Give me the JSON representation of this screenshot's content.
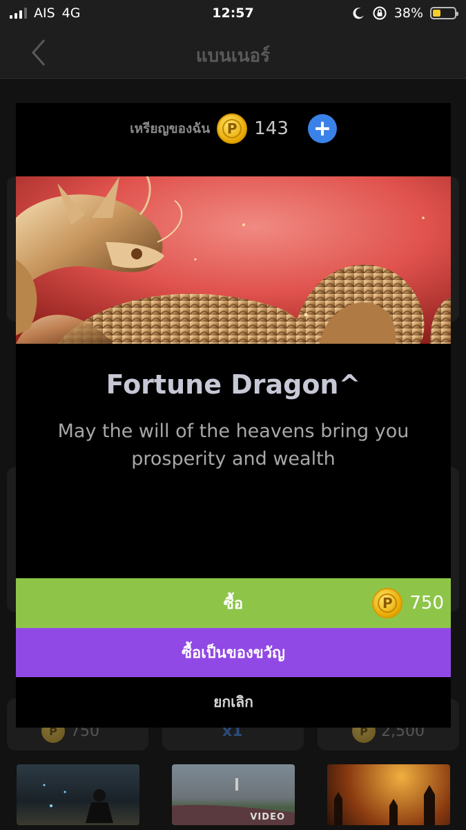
{
  "status_bar": {
    "carrier": "AIS",
    "network": "4G",
    "time": "12:57",
    "battery": "38%",
    "battery_level": 0.38,
    "icons": [
      "signal-icon",
      "moon-icon",
      "rotation-lock-icon",
      "battery-icon"
    ]
  },
  "header": {
    "title": "แบนเนอร์",
    "back_icon": "chevron-left-icon"
  },
  "modal": {
    "wallet_label": "เหรียญของฉัน",
    "coin_symbol": "P",
    "coin_count": "143",
    "add_icon": "plus-icon",
    "banner_image": "golden-dragon-on-red",
    "item_title": "Fortune Dragon^",
    "item_description": "May the will of the heavens bring you prosperity and wealth",
    "buy_label": "ซื้อ",
    "buy_price": "750",
    "gift_label": "ซื้อเป็นของขวัญ",
    "cancel_label": "ยกเลิก"
  },
  "background": {
    "prices": [
      "750",
      "x1",
      "2,500"
    ],
    "video_tag": "VIDEO"
  },
  "colors": {
    "buy": "#8ec549",
    "gift": "#9149e6",
    "add": "#3b82e8",
    "coin": "#f2b90f"
  }
}
